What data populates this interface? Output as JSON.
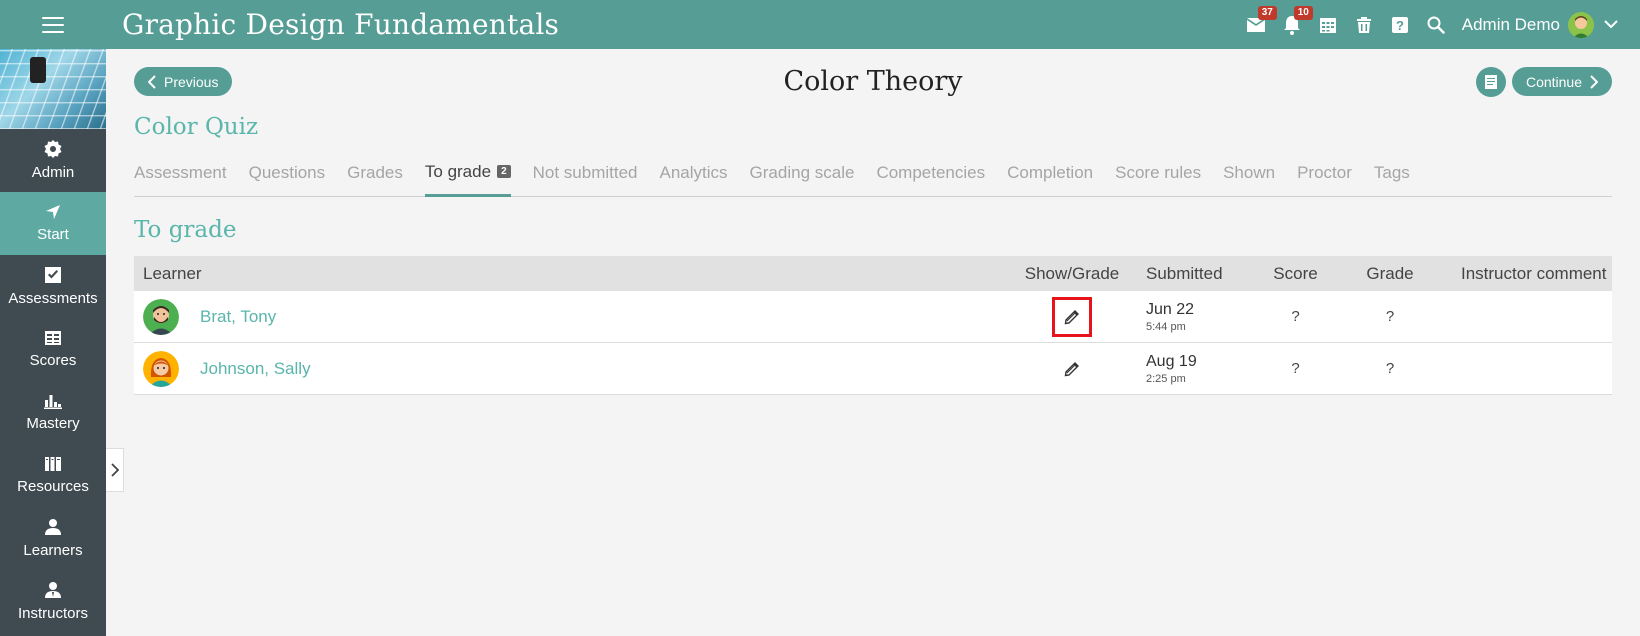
{
  "header": {
    "course_title": "Graphic Design Fundamentals",
    "messages_count": "37",
    "notifications_count": "10",
    "user_name": "Admin Demo"
  },
  "sidebar": {
    "items": [
      {
        "label": "Admin",
        "icon": "gear-icon"
      },
      {
        "label": "Start",
        "icon": "navigation-arrow-icon"
      },
      {
        "label": "Assessments",
        "icon": "checkbox-icon"
      },
      {
        "label": "Scores",
        "icon": "scores-icon"
      },
      {
        "label": "Mastery",
        "icon": "bar-chart-icon"
      },
      {
        "label": "Resources",
        "icon": "books-icon"
      },
      {
        "label": "Learners",
        "icon": "person-icon"
      },
      {
        "label": "Instructors",
        "icon": "instructor-icon"
      }
    ]
  },
  "page": {
    "previous_label": "Previous",
    "continue_label": "Continue",
    "title": "Color Theory",
    "quiz_title": "Color Quiz",
    "section_title": "To grade"
  },
  "tabs": [
    {
      "label": "Assessment"
    },
    {
      "label": "Questions"
    },
    {
      "label": "Grades"
    },
    {
      "label": "To grade",
      "count": "2"
    },
    {
      "label": "Not submitted"
    },
    {
      "label": "Analytics"
    },
    {
      "label": "Grading scale"
    },
    {
      "label": "Competencies"
    },
    {
      "label": "Completion"
    },
    {
      "label": "Score rules"
    },
    {
      "label": "Shown"
    },
    {
      "label": "Proctor"
    },
    {
      "label": "Tags"
    }
  ],
  "table": {
    "headers": {
      "learner": "Learner",
      "show_grade": "Show/Grade",
      "submitted": "Submitted",
      "score": "Score",
      "grade": "Grade",
      "comment": "Instructor comment"
    },
    "rows": [
      {
        "name": "Brat, Tony",
        "date": "Jun 22",
        "time": "5:44 pm",
        "score": "?",
        "grade": "?"
      },
      {
        "name": "Johnson, Sally",
        "date": "Aug 19",
        "time": "2:25 pm",
        "score": "?",
        "grade": "?"
      }
    ]
  },
  "colors": {
    "brand": "#559d95",
    "accent_text": "#5ab5ab",
    "sidebar_bg": "#3f4b50",
    "badge": "#c0392b",
    "highlight": "#e8141b"
  }
}
